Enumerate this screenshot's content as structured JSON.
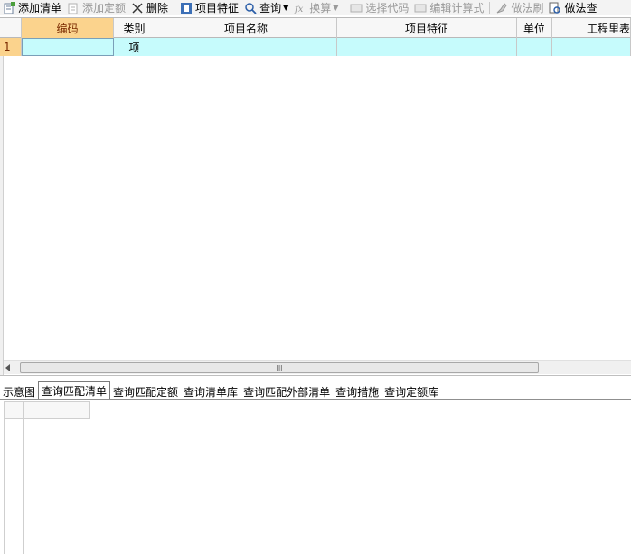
{
  "toolbar": {
    "add_list": "添加清单",
    "add_quota": "添加定额",
    "delete": "删除",
    "item_feature": "项目特征",
    "query": "查询",
    "convert": "换算",
    "select_code": "选择代码",
    "edit_formula": "编辑计算式",
    "brush": "做法刷",
    "method_query": "做法查"
  },
  "grid": {
    "headers": {
      "code": "编码",
      "category": "类别",
      "name": "项目名称",
      "feature": "项目特征",
      "unit": "单位",
      "quantity": "工程里表"
    },
    "rows": [
      {
        "num": "1",
        "code": "",
        "category": "项",
        "name": "",
        "feature": "",
        "unit": "",
        "quantity": ""
      }
    ]
  },
  "scrollbar": {
    "thumb_grip": "III"
  },
  "tabs": {
    "schematic": "示意图",
    "query_match_list": "查询匹配清单",
    "query_match_quota": "查询匹配定额",
    "query_list_lib": "查询清单库",
    "query_match_external": "查询匹配外部清单",
    "query_measures": "查询措施",
    "query_quota_lib": "查询定额库"
  },
  "colors": {
    "header_active": "#fbd38d",
    "row_fill": "#c6fbfc",
    "toolbar_bg": "#f3f3f3"
  }
}
